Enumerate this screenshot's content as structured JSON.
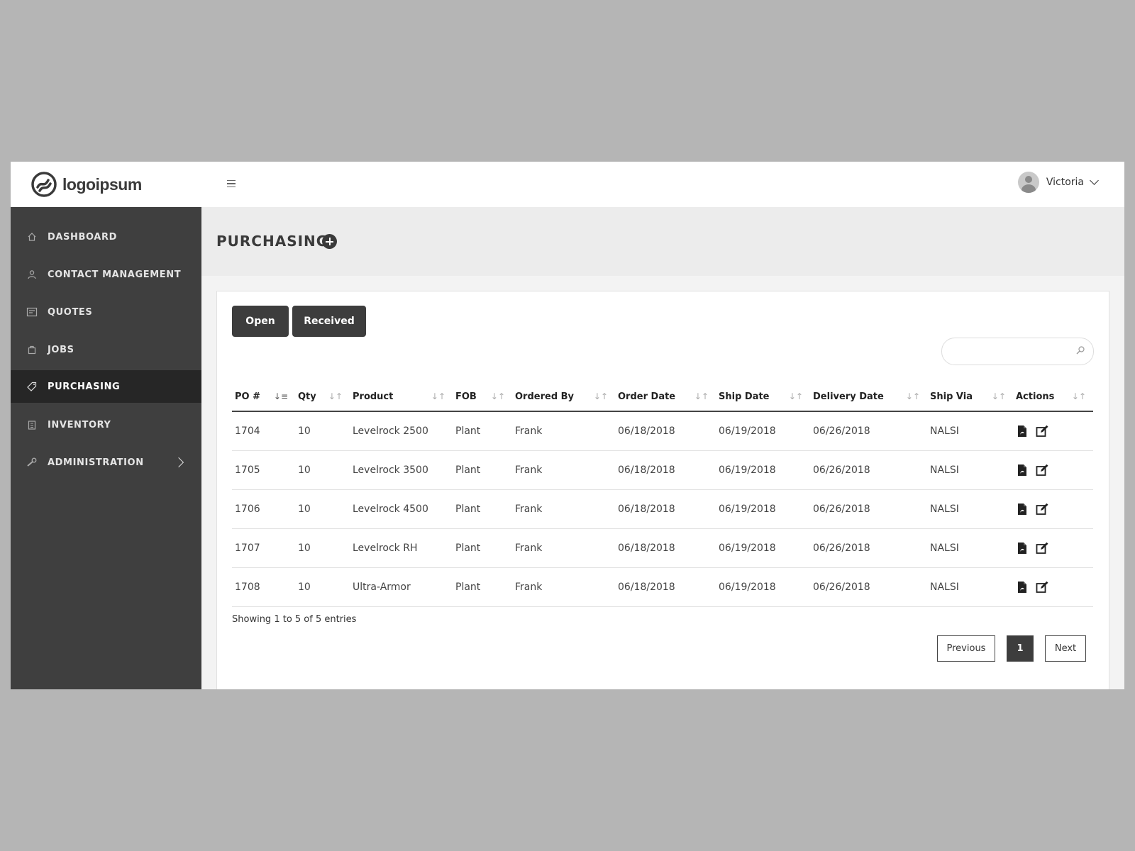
{
  "brand": {
    "name": "logoipsum"
  },
  "user": {
    "name": "Victoria"
  },
  "sidebar": {
    "items": [
      {
        "label": "DASHBOARD",
        "icon": "home-icon"
      },
      {
        "label": "CONTACT MANAGEMENT",
        "icon": "user-icon"
      },
      {
        "label": "QUOTES",
        "icon": "quote-icon"
      },
      {
        "label": "JOBS",
        "icon": "bag-icon"
      },
      {
        "label": "PURCHASING",
        "icon": "tag-icon",
        "active": true
      },
      {
        "label": "INVENTORY",
        "icon": "clipboard-icon"
      },
      {
        "label": "ADMINISTRATION",
        "icon": "wrench-icon",
        "has_submenu": true
      }
    ]
  },
  "page": {
    "title": "PURCHASING"
  },
  "tabs": {
    "open": "Open",
    "received": "Received"
  },
  "search": {
    "value": "",
    "placeholder": ""
  },
  "table": {
    "columns": [
      "PO #",
      "Qty",
      "Product",
      "FOB",
      "Ordered By",
      "Order Date",
      "Ship Date",
      "Delivery Date",
      "Ship Via",
      "Actions"
    ],
    "rows": [
      [
        "1704",
        "10",
        "Levelrock 2500",
        "Plant",
        "Frank",
        "06/18/2018",
        "06/19/2018",
        "06/26/2018",
        "NALSI"
      ],
      [
        "1705",
        "10",
        "Levelrock 3500",
        "Plant",
        "Frank",
        "06/18/2018",
        "06/19/2018",
        "06/26/2018",
        "NALSI"
      ],
      [
        "1706",
        "10",
        "Levelrock 4500",
        "Plant",
        "Frank",
        "06/18/2018",
        "06/19/2018",
        "06/26/2018",
        "NALSI"
      ],
      [
        "1707",
        "10",
        "Levelrock RH",
        "Plant",
        "Frank",
        "06/18/2018",
        "06/19/2018",
        "06/26/2018",
        "NALSI"
      ],
      [
        "1708",
        "10",
        "Ultra-Armor",
        "Plant",
        "Frank",
        "06/18/2018",
        "06/19/2018",
        "06/26/2018",
        "NALSI"
      ]
    ]
  },
  "info": "Showing 1 to 5 of 5 entries",
  "pagination": {
    "previous": "Previous",
    "current": "1",
    "next": "Next"
  },
  "colors": {
    "sidebar": "#3f3f3f",
    "sidebar_active": "#262626",
    "button": "#3d3d3d",
    "page_header": "#ececec"
  }
}
